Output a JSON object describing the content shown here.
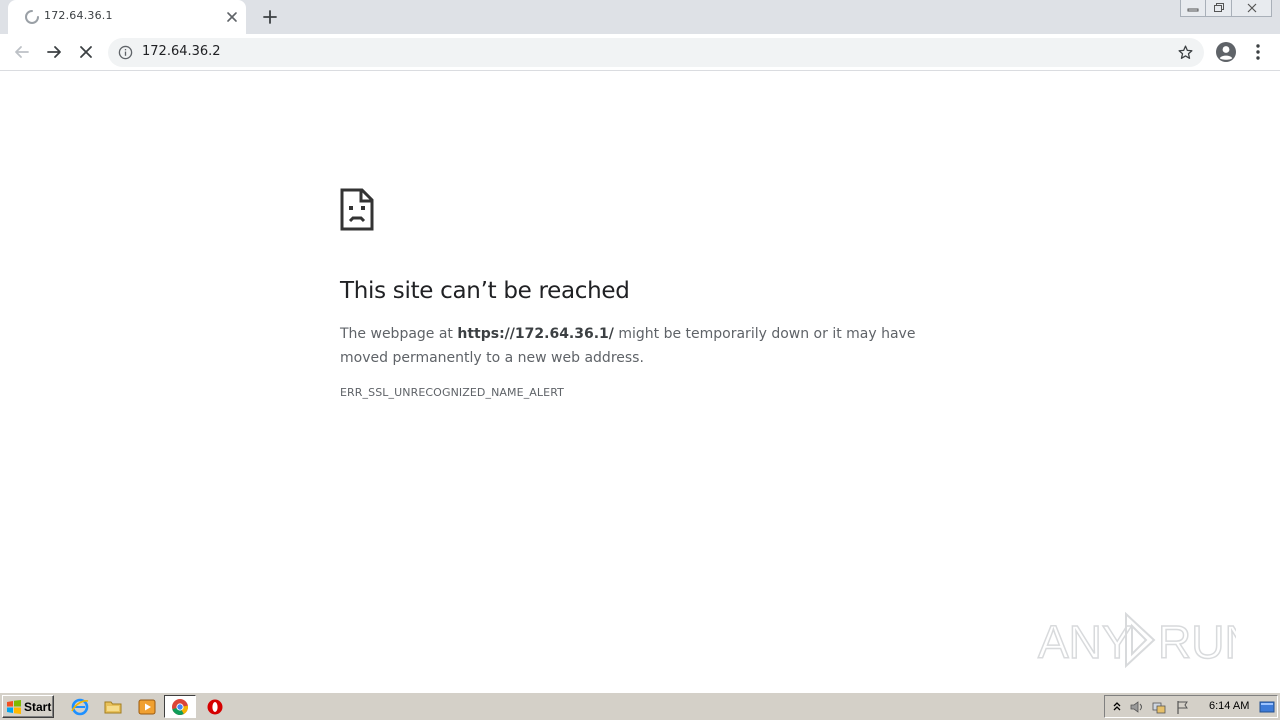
{
  "browser": {
    "tab": {
      "title": "172.64.36.1",
      "loading": true
    },
    "address_bar": {
      "url": "172.64.36.2"
    },
    "icons": {
      "back": "back-arrow-icon",
      "forward": "forward-arrow-icon",
      "stop": "stop-icon",
      "info": "info-icon",
      "bookmark": "star-icon",
      "profile": "profile-icon",
      "menu": "kebab-menu-icon"
    }
  },
  "error_page": {
    "title": "This site can’t be reached",
    "desc_prefix": "The webpage at ",
    "desc_url": "https://172.64.36.1/",
    "desc_suffix": " might be temporarily down or it may have moved permanently to a new web address.",
    "error_code": "ERR_SSL_UNRECOGNIZED_NAME_ALERT"
  },
  "watermark": {
    "text": "ANY RUN"
  },
  "taskbar": {
    "start_label": "Start",
    "apps": [
      "internet-explorer-icon",
      "folder-icon",
      "media-player-icon",
      "chrome-icon",
      "opera-icon"
    ],
    "clock": "6:14 AM"
  },
  "colors": {
    "tabstrip": "#dee1e6",
    "omnibox": "#f1f3f4",
    "title_text": "#202124",
    "body_text": "#5f6368",
    "taskbar": "#d4d0c8"
  }
}
